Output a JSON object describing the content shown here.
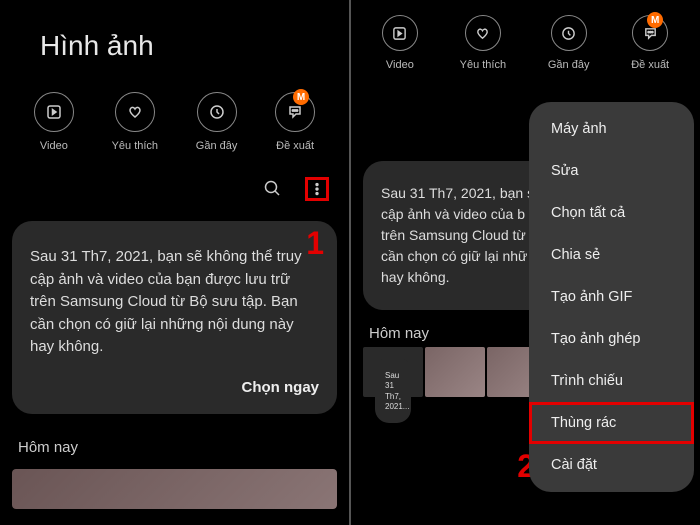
{
  "title": "Hình ảnh",
  "tabs": [
    {
      "label": "Video",
      "icon": "play"
    },
    {
      "label": "Yêu thích",
      "icon": "heart"
    },
    {
      "label": "Gần đây",
      "icon": "clock"
    },
    {
      "label": "Đề xuất",
      "icon": "chat",
      "badge": "M"
    }
  ],
  "notice": {
    "text": "Sau 31 Th7, 2021, bạn sẽ không thể truy cập ảnh và video của bạn được lưu trữ trên Samsung Cloud từ Bộ sưu tập. Bạn cần chọn có giữ lại những nội dung này hay không.",
    "partial": "Sau 31 Th7, 2021, bạn s\ncập ảnh và video của b\ntrên Samsung Cloud từ\ncần chọn có giữ lại nhữ\nhay không.",
    "action": "Chọn ngay"
  },
  "section": "Hôm nay",
  "step1": "1",
  "step2": "2",
  "menu": [
    "Máy ảnh",
    "Sửa",
    "Chọn tất cả",
    "Chia sẻ",
    "Tạo ảnh GIF",
    "Tạo ảnh ghép",
    "Trình chiếu",
    "Thùng rác",
    "Cài đặt"
  ]
}
